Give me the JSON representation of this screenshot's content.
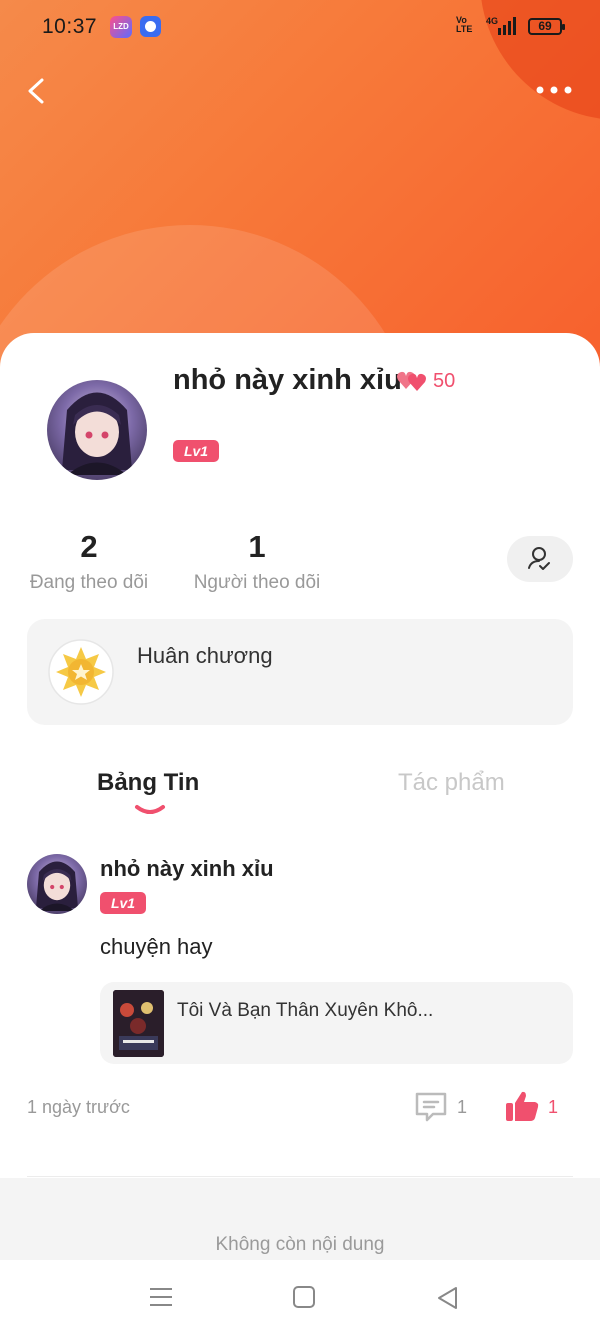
{
  "status_bar": {
    "time": "10:37",
    "app1_label": "Lazada",
    "volte": "Vo LTE",
    "network": "4G",
    "battery": "69"
  },
  "profile": {
    "name": "nhỏ này xinh xỉu",
    "hearts_count": "50",
    "level": "Lv1",
    "following_count": "2",
    "following_label": "Đang theo dõi",
    "followers_count": "1",
    "followers_label": "Người theo dõi"
  },
  "medal": {
    "label": "Huân chương"
  },
  "tabs": [
    {
      "label": "Bảng Tin",
      "active": true
    },
    {
      "label": "Tác phẩm",
      "active": false
    }
  ],
  "post": {
    "author": "nhỏ này xinh xỉu",
    "level": "Lv1",
    "text": "chuyện hay",
    "book_title": "Tôi Và Bạn Thân Xuyên Khô...",
    "time": "1 ngày trước",
    "comment_count": "1",
    "like_count": "1"
  },
  "footer": {
    "end_text": "Không còn nội dung"
  },
  "colors": {
    "accent": "#f0506e",
    "hero_orange": "#f77a3a",
    "hero_red": "#f7602d"
  }
}
